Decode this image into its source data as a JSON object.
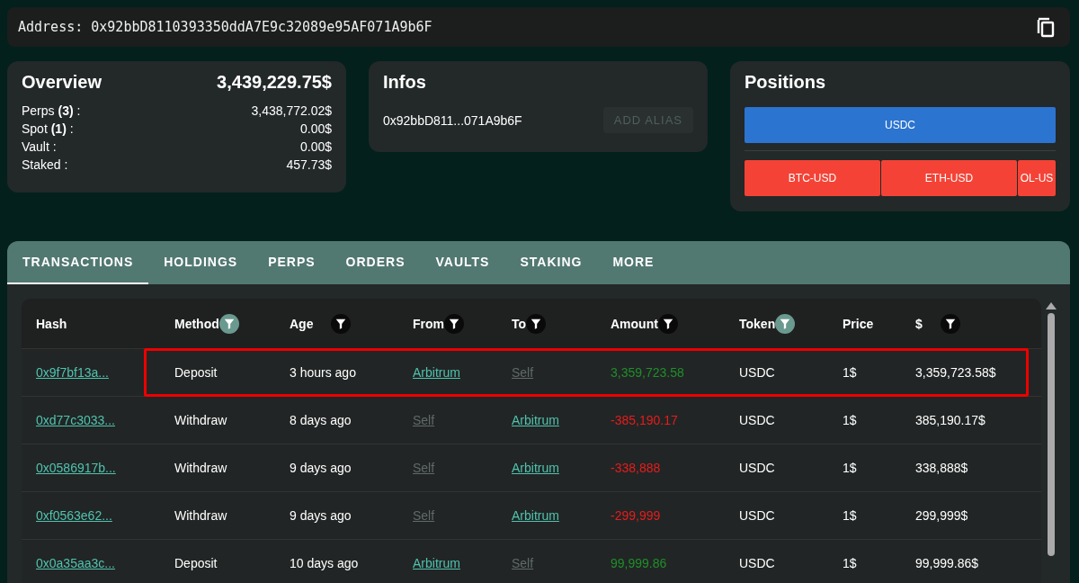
{
  "address": {
    "label": "Address:",
    "value": "0x92bbD8110393350ddA7E9c32089e95AF071A9b6F"
  },
  "overview": {
    "title": "Overview",
    "total": "3,439,229.75$",
    "rows": [
      {
        "label": "Perps **(3)** :",
        "value": "3,438,772.02$"
      },
      {
        "label": "Spot **(1)** :",
        "value": "0.00$"
      },
      {
        "label": "Vault :",
        "value": "0.00$"
      },
      {
        "label": "Staked :",
        "value": "457.73$"
      }
    ]
  },
  "infos": {
    "title": "Infos",
    "short_address": "0x92bbD811...071A9b6F",
    "button": {
      "label": "ADD ALIAS",
      "disabled": true
    }
  },
  "positions": {
    "title": "Positions",
    "spot": [
      {
        "label": "USDC",
        "color": "#2b74d0"
      }
    ],
    "perps": [
      {
        "label": "BTC-USD",
        "color": "#f44336"
      },
      {
        "label": "ETH-USD",
        "color": "#f44336"
      },
      {
        "label": "OL-US",
        "color": "#f44336"
      }
    ]
  },
  "tabs": [
    {
      "label": "TRANSACTIONS",
      "selected": true
    },
    {
      "label": "HOLDINGS",
      "selected": false
    },
    {
      "label": "PERPS",
      "selected": false
    },
    {
      "label": "ORDERS",
      "selected": false
    },
    {
      "label": "VAULTS",
      "selected": false
    },
    {
      "label": "STAKING",
      "selected": false
    },
    {
      "label": "MORE",
      "selected": false
    }
  ],
  "table": {
    "columns": [
      {
        "label": "Hash",
        "filter": false
      },
      {
        "label": "Method",
        "filter": true,
        "filter_active": true
      },
      {
        "label": "Age",
        "filter": true,
        "filter_active": false
      },
      {
        "label": "From",
        "filter": true,
        "filter_active": false
      },
      {
        "label": "To",
        "filter": true,
        "filter_active": false
      },
      {
        "label": "Amount",
        "filter": true,
        "filter_active": false
      },
      {
        "label": "Token",
        "filter": true,
        "filter_active": true
      },
      {
        "label": "Price",
        "filter": false
      },
      {
        "label": "$",
        "filter": true,
        "filter_active": false
      }
    ],
    "rows": [
      {
        "highlighted": true,
        "hash": "0x9f7bf13a...",
        "method": "Deposit",
        "age": "3 hours ago",
        "from": {
          "label": "Arbitrum",
          "self": false
        },
        "to": {
          "label": "Self",
          "self": true
        },
        "amount": "3,359,723.58",
        "incoming": true,
        "token": "USDC",
        "price": "1$",
        "usd": "3,359,723.58$"
      },
      {
        "highlighted": false,
        "hash": "0xd77c3033...",
        "method": "Withdraw",
        "age": "8 days ago",
        "from": {
          "label": "Self",
          "self": true
        },
        "to": {
          "label": "Arbitrum",
          "self": false
        },
        "amount": "-385,190.17",
        "incoming": false,
        "token": "USDC",
        "price": "1$",
        "usd": "385,190.17$"
      },
      {
        "highlighted": false,
        "hash": "0x0586917b...",
        "method": "Withdraw",
        "age": "9 days ago",
        "from": {
          "label": "Self",
          "self": true
        },
        "to": {
          "label": "Arbitrum",
          "self": false
        },
        "amount": "-338,888",
        "incoming": false,
        "token": "USDC",
        "price": "1$",
        "usd": "338,888$"
      },
      {
        "highlighted": false,
        "hash": "0xf0563e62...",
        "method": "Withdraw",
        "age": "9 days ago",
        "from": {
          "label": "Self",
          "self": true
        },
        "to": {
          "label": "Arbitrum",
          "self": false
        },
        "amount": "-299,999",
        "incoming": false,
        "token": "USDC",
        "price": "1$",
        "usd": "299,999$"
      },
      {
        "highlighted": false,
        "hash": "0x0a35aa3c...",
        "method": "Deposit",
        "age": "10 days ago",
        "from": {
          "label": "Arbitrum",
          "self": false
        },
        "to": {
          "label": "Self",
          "self": true
        },
        "amount": "99,999.86",
        "incoming": true,
        "token": "USDC",
        "price": "1$",
        "usd": "99,999.86$"
      }
    ]
  }
}
